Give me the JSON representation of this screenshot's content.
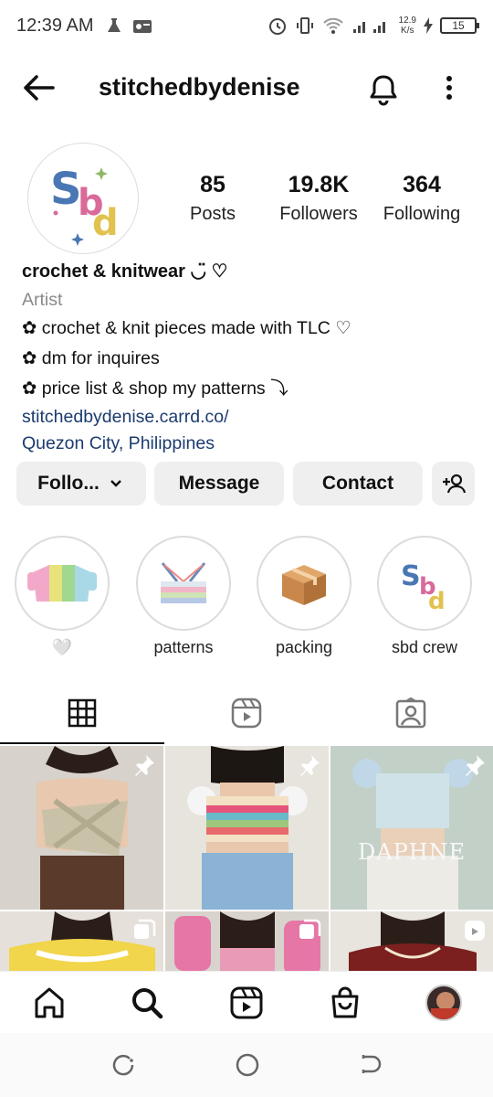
{
  "status_bar": {
    "time": "12:39 AM",
    "net_speed": "12.9",
    "net_unit": "K/s",
    "battery": "15"
  },
  "header": {
    "username": "stitchedbydenise"
  },
  "profile": {
    "stats": [
      {
        "value": "85",
        "label": "Posts"
      },
      {
        "value": "19.8K",
        "label": "Followers"
      },
      {
        "value": "364",
        "label": "Following"
      }
    ],
    "name": "crochet & knitwear ◡̈ ♡",
    "category": "Artist",
    "bio_lines": [
      "✿ crochet & knit pieces made with TLC ♡",
      "✿ dm for inquires",
      "✿ price list & shop my patterns ⤵"
    ],
    "link": "stitchedbydenise.carrd.co/",
    "location": "Quezon City, Philippines"
  },
  "actions": {
    "follow": "Follo...",
    "message": "Message",
    "contact": "Contact"
  },
  "highlights": [
    {
      "label": "🤍"
    },
    {
      "label": "patterns"
    },
    {
      "label": "packing"
    },
    {
      "label": "sbd crew"
    }
  ],
  "colors": {
    "accent_link": "#1b3b6f",
    "button_bg": "#efefef",
    "muted": "#8a8a8a"
  },
  "grid_posts": [
    {
      "overlay_text": ""
    },
    {
      "overlay_text": ""
    },
    {
      "overlay_text": "DAPHNE"
    },
    {
      "overlay_text": ""
    },
    {
      "overlay_text": ""
    },
    {
      "overlay_text": ""
    }
  ]
}
